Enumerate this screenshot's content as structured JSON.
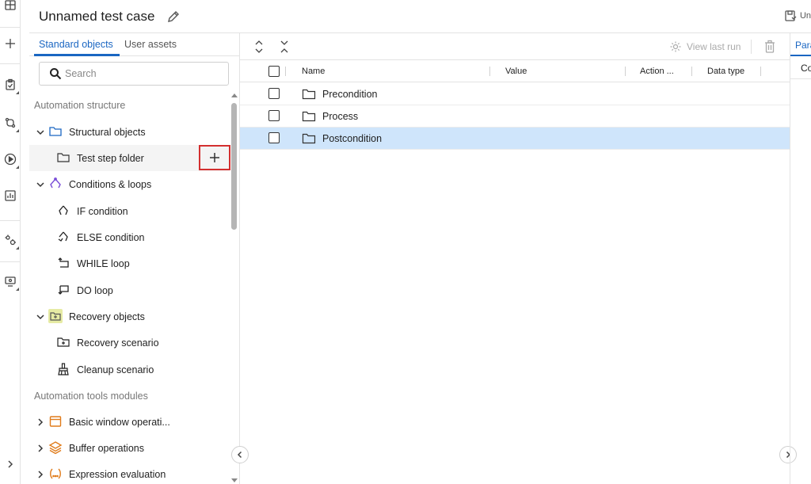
{
  "header": {
    "title": "Unnamed test case",
    "action_label": "Un"
  },
  "left_panel": {
    "tabs": [
      {
        "label": "Standard objects",
        "active": true
      },
      {
        "label": "User assets",
        "active": false
      }
    ],
    "search": {
      "placeholder": "Search",
      "value": ""
    },
    "sections": {
      "automation_structure": "Automation structure",
      "automation_tools_modules": "Automation tools modules"
    },
    "tree": {
      "structural_objects": "Structural objects",
      "test_step_folder": "Test step folder",
      "conditions_loops": "Conditions & loops",
      "if_condition": "IF condition",
      "else_condition": "ELSE condition",
      "while_loop": "WHILE loop",
      "do_loop": "DO loop",
      "recovery_objects": "Recovery objects",
      "recovery_scenario": "Recovery scenario",
      "cleanup_scenario": "Cleanup scenario",
      "basic_window_operations": "Basic window operati...",
      "buffer_operations": "Buffer operations",
      "expression_evaluation": "Expression evaluation"
    }
  },
  "toolbar": {
    "view_last_run": "View last run"
  },
  "table": {
    "columns": [
      "Name",
      "Value",
      "Action ...",
      "Data type"
    ],
    "rows": [
      {
        "name": "Precondition",
        "selected": false
      },
      {
        "name": "Process",
        "selected": false
      },
      {
        "name": "Postcondition",
        "selected": true
      }
    ]
  },
  "right_panel": {
    "tab": "Para",
    "column": "Co"
  },
  "colors": {
    "accent": "#1a66c2",
    "selection": "#cfe5fb",
    "highlight_box": "#d32f2f",
    "conditions_icon": "#7b4fd8",
    "recovery_icon_bg": "#e6eba4",
    "tools_icon": "#e07b1a"
  }
}
